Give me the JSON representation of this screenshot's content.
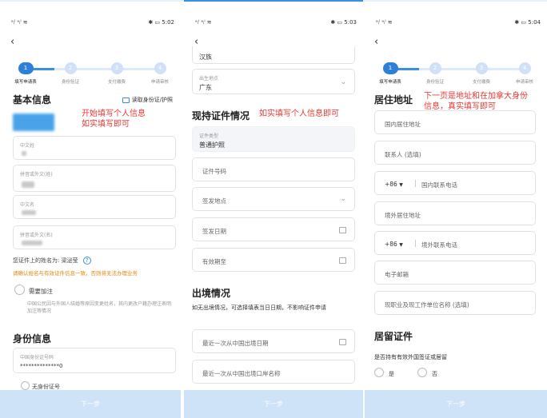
{
  "status": {
    "signal": "ᵃᵢˡ ᵃᵢˡ ≋",
    "p1_right": "✱ ▭ 5:02",
    "p2_right": "✱ ▭ 5:03",
    "p3_right": "✱ ▭ 5:04"
  },
  "back_glyph": "‹",
  "steps": [
    {
      "num": "1",
      "label": "填写申请表"
    },
    {
      "num": "2",
      "label": "身份验证"
    },
    {
      "num": "3",
      "label": "支付缴费"
    },
    {
      "num": "4",
      "label": "申请审核"
    }
  ],
  "p1": {
    "section_basic": "基本信息",
    "read_id_button": "读取身份证/护照",
    "note": "开始填写个人信息\n如实填写即可",
    "fields": [
      {
        "label": "中文姓"
      },
      {
        "label": "拼音或外文(姓)"
      },
      {
        "label": "中文名"
      },
      {
        "label": "拼音或外文(名)"
      }
    ],
    "name_display": "您证件上的姓名为: 梁泌莹",
    "warning": "请确认姓名与有效证件信息一致，否则将无法办理业务",
    "need_add": "需要加注",
    "add_desc": "中国公民因与外国人结婚等原因变更姓名，其内更改户籍办理注表明加注等情况",
    "section_id": "身份信息",
    "id_label": "中国身份证号码",
    "id_value": "**************0",
    "no_id": "无身份证号",
    "next": "下一步"
  },
  "p2": {
    "top_value": "汉族",
    "birth_label": "出生地点",
    "birth_value": "广东",
    "section_cert": "现持证件情况",
    "note": "如实填写个人信息即可",
    "cert_type_label": "证件类型",
    "cert_type_value": "普通护照",
    "cert_number": "证件号码",
    "issue_place": "签发地点",
    "issue_date": "签发日期",
    "valid_until": "有效期至",
    "section_exit": "出境情况",
    "exit_desc": "如无出境情况，可选择填表当日日期，不影响证件申请",
    "last_exit_date": "最近一次从中国出境日期",
    "last_exit_port": "最近一次从中国出境口岸名称",
    "next": "下一步"
  },
  "p3": {
    "section_residence": "居住地址",
    "note": "下一页是地址和在加拿大身份\n信息，真实填写即可",
    "domestic_address": "国内居住地址",
    "contact_person": "联系人 (选填)",
    "country_code": "+86",
    "domestic_phone": "国内联系电话",
    "overseas_address": "境外居住地址",
    "overseas_phone": "境外联系电话",
    "email": "电子邮箱",
    "occupation": "现职业及现工作单位名称 (选填)",
    "section_residency": "居留证件",
    "residency_question": "是否持有有效外国签证或居留",
    "yes": "是",
    "no": "否",
    "next": "下一步"
  }
}
